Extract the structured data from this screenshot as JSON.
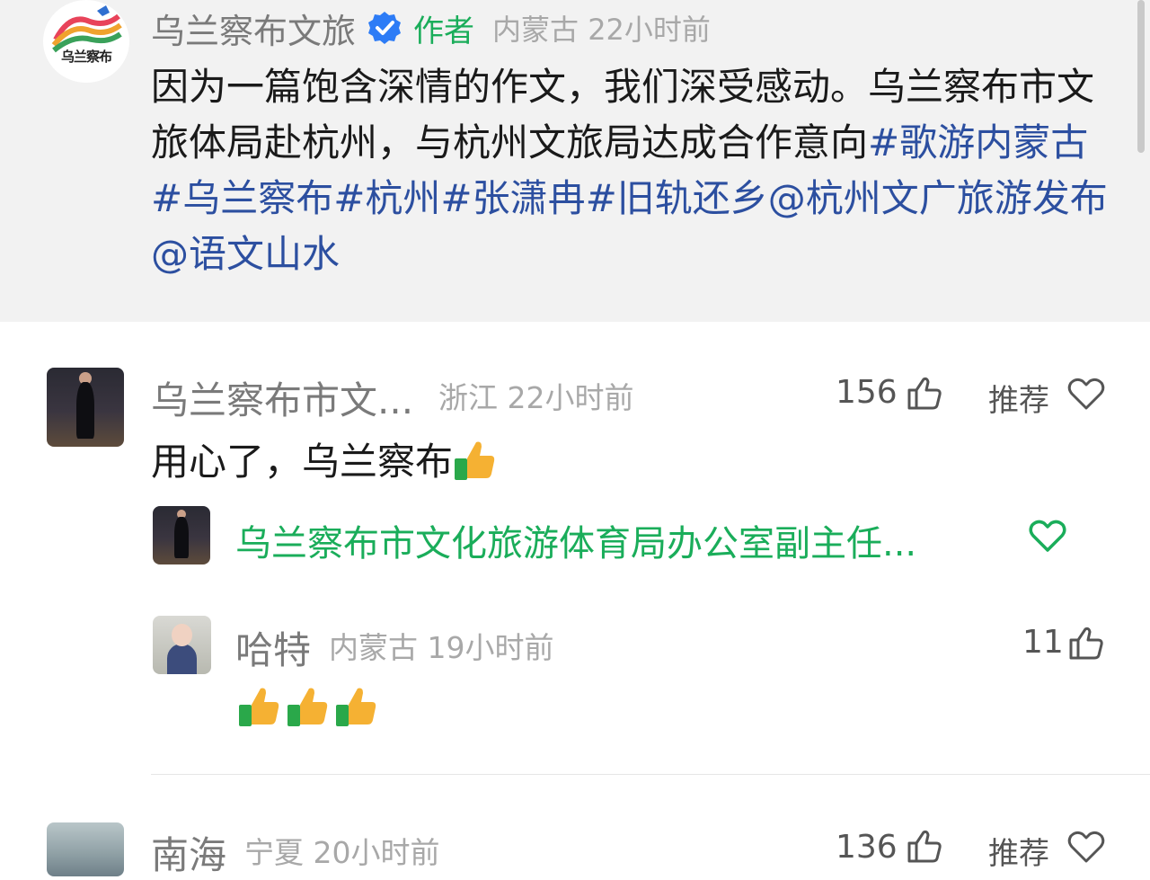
{
  "post": {
    "author_name": "乌兰察布文旅",
    "author_tag": "作者",
    "author_meta": "内蒙古 22小时前",
    "logo_label": "乌兰察布",
    "text_plain": "因为一篇饱含深情的作文，我们深受感动。乌兰察布市文旅体局赴杭州，与杭州文旅局达成合作意向",
    "text_links": "#歌游内蒙古#乌兰察布#杭州#张潇冉#旧轨还乡@杭州文广旅游发布 @语文山水"
  },
  "comments": [
    {
      "name": "乌兰察布市文...",
      "meta": "浙江 22小时前",
      "likes": "156",
      "recommend_label": "推荐",
      "text": "用心了，乌兰察布",
      "reply_preview": "乌兰察布市文化旅游体育局办公室副主任..."
    },
    {
      "name": "哈特",
      "meta": "内蒙古 19小时前",
      "likes": "11",
      "emoji_count": 3
    },
    {
      "name": "南海",
      "meta": "宁夏 20小时前",
      "likes": "136",
      "recommend_label": "推荐"
    }
  ],
  "colors": {
    "link": "#2c4fa0",
    "accent_green": "#1aad5a",
    "meta_gray": "#a8a8a8",
    "header_bg": "#f2f2f2",
    "verified_blue": "#2d7cf6"
  },
  "icons": [
    "verified-icon",
    "thumbs-up-icon",
    "heart-icon",
    "thumbs-up-emoji"
  ]
}
